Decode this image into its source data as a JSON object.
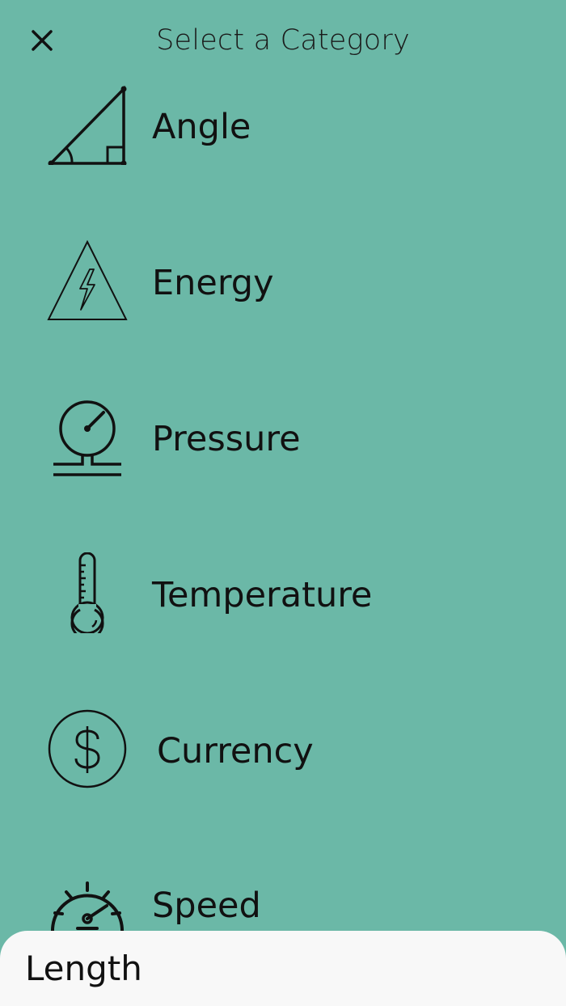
{
  "header": {
    "title": "Select a Category",
    "close_icon": "close-icon"
  },
  "categories": [
    {
      "label": "Angle",
      "icon": "angle-icon"
    },
    {
      "label": "Energy",
      "icon": "energy-icon"
    },
    {
      "label": "Pressure",
      "icon": "pressure-gauge-icon"
    },
    {
      "label": "Temperature",
      "icon": "thermometer-icon"
    },
    {
      "label": "Currency",
      "icon": "dollar-icon"
    },
    {
      "label": "Speed",
      "icon": "speedometer-icon"
    }
  ],
  "selected": {
    "label": "Length"
  },
  "colors": {
    "background": "#6bb8a7",
    "sheet": "#f8f8f8",
    "text": "#111111"
  }
}
